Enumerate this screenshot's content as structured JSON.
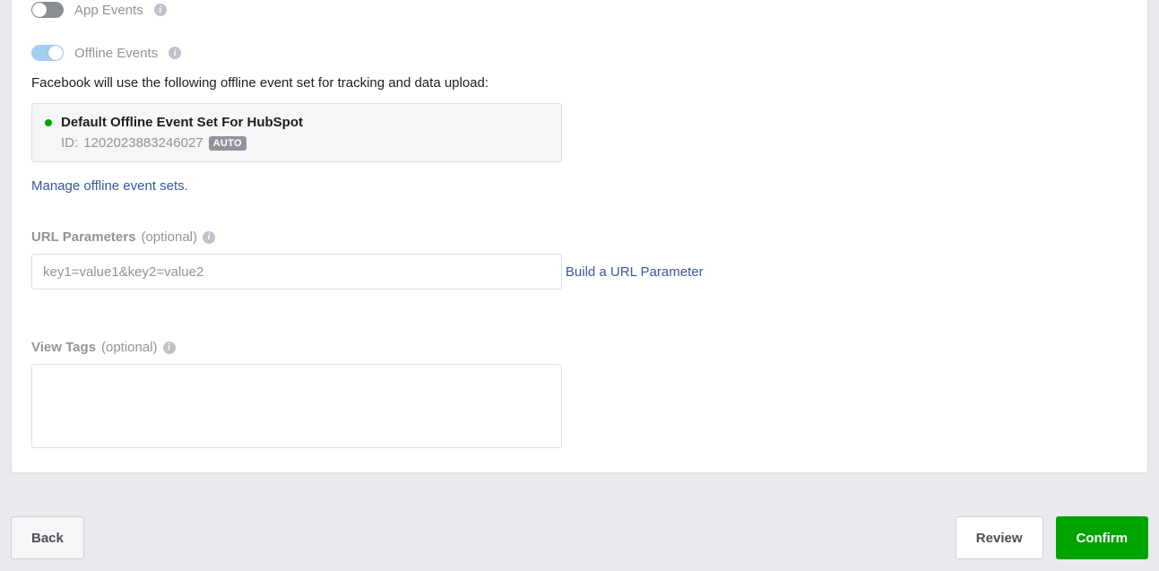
{
  "toggles": {
    "app_events": {
      "label": "App Events",
      "on": false
    },
    "offline_events": {
      "label": "Offline Events",
      "on": true
    }
  },
  "offline": {
    "description": "Facebook will use the following offline event set for tracking and data upload:",
    "event_set": {
      "title": "Default Offline Event Set For HubSpot",
      "id_prefix": "ID:",
      "id": "1202023883246027",
      "badge": "AUTO"
    },
    "manage_link": "Manage offline event sets."
  },
  "url_params": {
    "label": "URL Parameters",
    "optional": "(optional)",
    "placeholder": "key1=value1&key2=value2",
    "value": "",
    "build_link": "Build a URL Parameter"
  },
  "view_tags": {
    "label": "View Tags",
    "optional": "(optional)",
    "value": ""
  },
  "footer": {
    "back": "Back",
    "review": "Review",
    "confirm": "Confirm"
  }
}
